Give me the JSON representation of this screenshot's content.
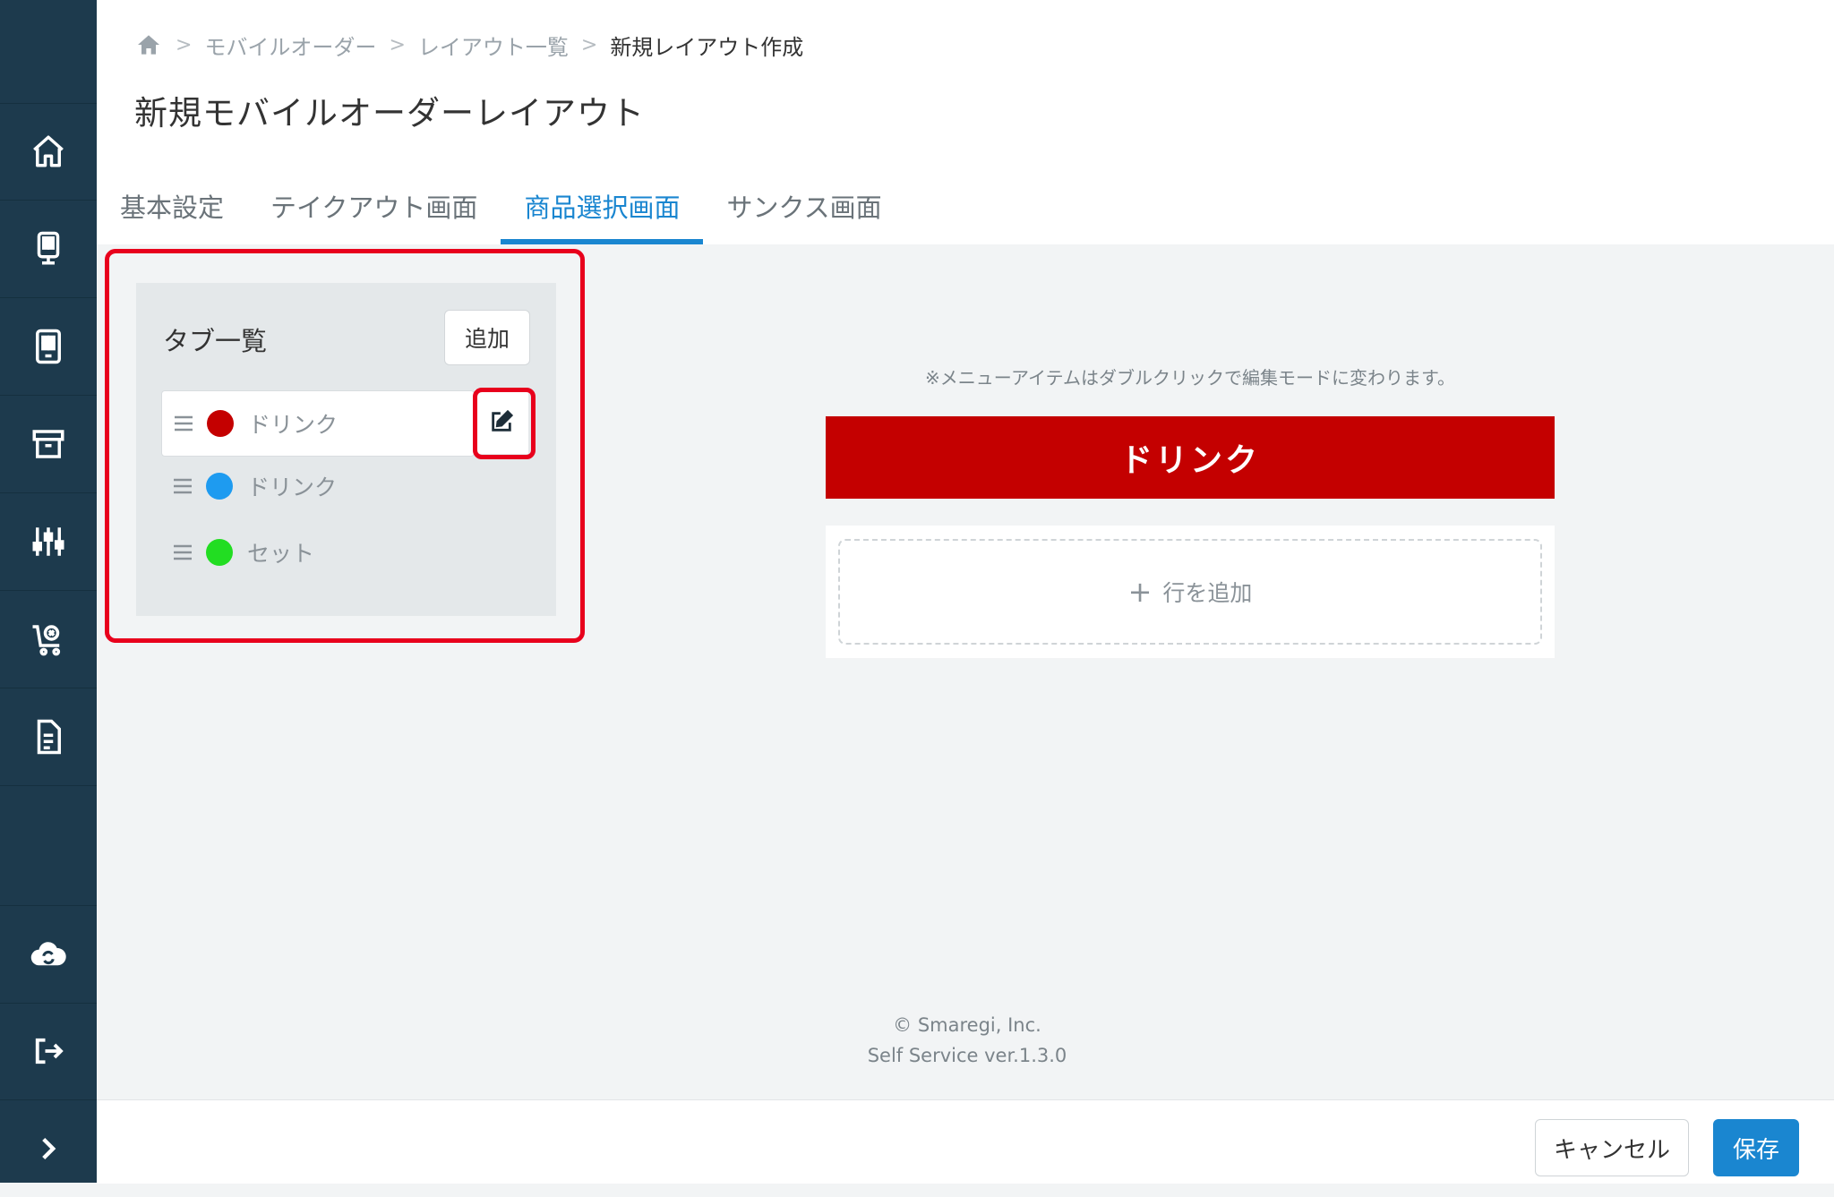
{
  "breadcrumb": {
    "items": [
      "モバイルオーダー",
      "レイアウト一覧",
      "新規レイアウト作成"
    ]
  },
  "page": {
    "title": "新規モバイルオーダーレイアウト"
  },
  "tabs": [
    {
      "label": "基本設定"
    },
    {
      "label": "テイクアウト画面"
    },
    {
      "label": "商品選択画面"
    },
    {
      "label": "サンクス画面"
    }
  ],
  "active_tab": "商品選択画面",
  "tab_list": {
    "title": "タブ一覧",
    "add_label": "追加",
    "items": [
      {
        "label": "ドリンク",
        "color": "#c40000"
      },
      {
        "label": "ドリンク",
        "color": "#1e9bf0"
      },
      {
        "label": "セット",
        "color": "#22dd22"
      }
    ]
  },
  "preview": {
    "hint": "※メニューアイテムはダブルクリックで編集モードに変わります。",
    "tab_name": "ドリンク",
    "tab_color": "#c40000",
    "add_row_label": "行を追加"
  },
  "footer": {
    "copyright": "© Smaregi, Inc.",
    "version": "Self Service ver.1.3.0"
  },
  "actions": {
    "cancel_label": "キャンセル",
    "save_label": "保存"
  },
  "colors": {
    "sidebar": "#1d3a4d",
    "accent": "#1a86d0",
    "highlight": "#e8001c"
  }
}
